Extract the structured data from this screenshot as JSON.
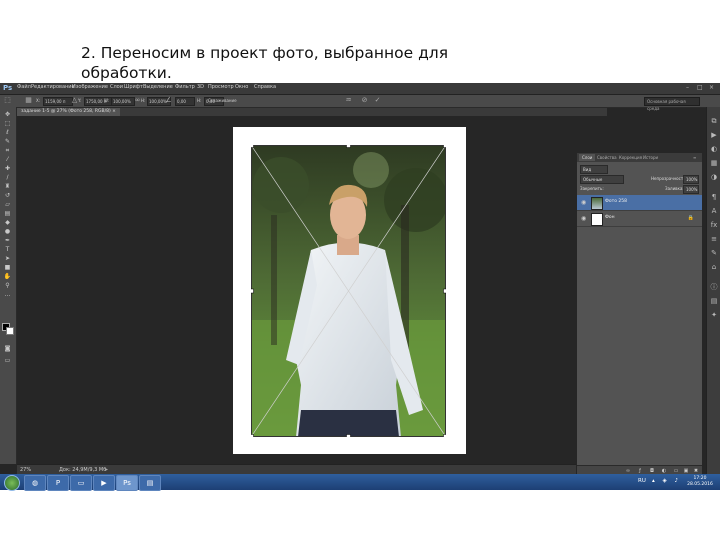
{
  "caption": {
    "line1": "2. Переносим в проект фото, выбранное для",
    "line2": "обработки."
  },
  "app": {
    "logo": "Ps",
    "menu": [
      "Файл",
      "Редактирование",
      "Изображение",
      "Слои",
      "Шрифт",
      "Выделение",
      "Фильтр",
      "3D",
      "Просмотр",
      "Окно",
      "Справка"
    ],
    "window_controls": [
      "–",
      "□",
      "×"
    ]
  },
  "options_bar": {
    "x_value": "1159,00 п",
    "y_value": "1750,00 п",
    "w_value": "100,00%",
    "h_value": "100,00%",
    "angle_value": "0,00",
    "h_skew_value": "0,00",
    "h_skew_label": "H:",
    "antialias_label": "Сглаживание",
    "workspace": "Основная рабочая среда"
  },
  "document": {
    "tab_title": "задание 1-5 @ 27% (Фото 258, RGB/8) ×",
    "zoom": "27%",
    "info": "Док: 24,9M/9,3 Мб"
  },
  "layers_panel": {
    "tabs": [
      "Слои",
      "Свойства",
      "Коррекция",
      "Истори"
    ],
    "kind_label": "Вид",
    "blend_mode": "Обычные",
    "opacity_label": "Непрозрачность:",
    "opacity_value": "100%",
    "lock_label": "Закрепить:",
    "fill_label": "Заливка:",
    "fill_value": "100%",
    "layers": [
      {
        "name": "Фото 258",
        "selected": true
      },
      {
        "name": "Фон",
        "selected": false
      }
    ]
  },
  "taskbar": {
    "lang": "RU",
    "time": "17:20",
    "date": "28.05.2016"
  },
  "colors": {
    "canvas_bg": "#262626",
    "panel_bg": "#535353",
    "selection": "#4a6fa5",
    "taskbar": "#2f5f9e"
  },
  "icons": {
    "tools": [
      "move-icon",
      "marquee-icon",
      "lasso-icon",
      "quick-select-icon",
      "crop-icon",
      "eyedropper-icon",
      "healing-icon",
      "brush-icon",
      "stamp-icon",
      "history-brush-icon",
      "eraser-icon",
      "gradient-icon",
      "blur-icon",
      "dodge-icon",
      "pen-icon",
      "type-icon",
      "path-select-icon",
      "shape-icon",
      "hand-icon",
      "zoom-icon"
    ]
  }
}
